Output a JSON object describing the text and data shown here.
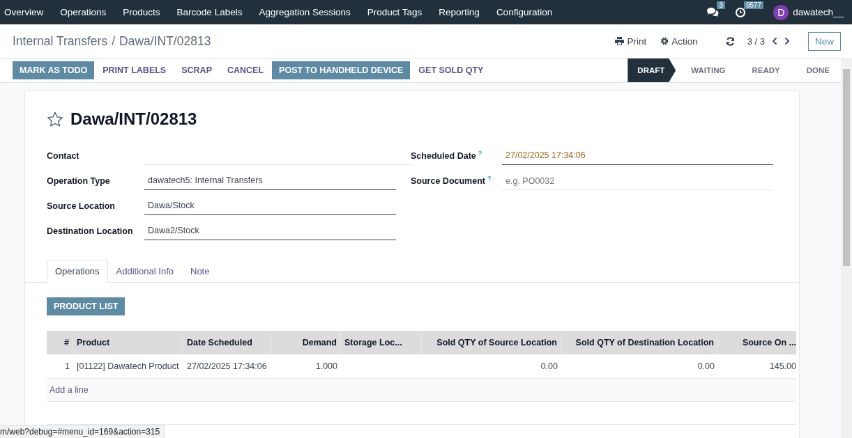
{
  "nav": {
    "items": [
      "Overview",
      "Operations",
      "Products",
      "Barcode Labels",
      "Aggregation Sessions",
      "Product Tags",
      "Reporting",
      "Configuration"
    ],
    "messages_badge": "3",
    "activity_badge": "9577",
    "avatar_letter": "D",
    "user": "dawatech__"
  },
  "control_panel": {
    "breadcrumb": [
      "Internal Transfers",
      "Dawa/INT/02813"
    ],
    "separator": "/",
    "print": "Print",
    "action": "Action",
    "pager": "3 / 3",
    "new": "New"
  },
  "action_buttons": [
    {
      "label": "MARK AS TODO",
      "kind": "primary"
    },
    {
      "label": "PRINT LABELS",
      "kind": "link"
    },
    {
      "label": "SCRAP",
      "kind": "link"
    },
    {
      "label": "CANCEL",
      "kind": "link"
    },
    {
      "label": "POST TO HANDHELD DEVICE",
      "kind": "primary"
    },
    {
      "label": "GET SOLD QTY",
      "kind": "link"
    }
  ],
  "statuses": [
    {
      "label": "DRAFT",
      "selected": true
    },
    {
      "label": "WAITING",
      "selected": false
    },
    {
      "label": "READY",
      "selected": false
    },
    {
      "label": "DONE",
      "selected": false
    }
  ],
  "form": {
    "title": "Dawa/INT/02813",
    "starred": false,
    "fields_left": [
      {
        "label": "Contact"
      },
      {
        "label": "Operation Type",
        "value": "dawatech5: Internal Transfers"
      },
      {
        "label": "Source Location",
        "value": "Dawa/Stock"
      },
      {
        "label": "Destination Location",
        "value": "Dawa2/Stock"
      }
    ],
    "fields_right": [
      {
        "label": "Scheduled Date",
        "help": "?",
        "value": "27/02/2025 17:34:06"
      },
      {
        "label": "Source Document",
        "help": "?",
        "placeholder": "e.g. PO0032"
      }
    ]
  },
  "tabs": [
    {
      "label": "Operations",
      "selected": true
    },
    {
      "label": "Additional Info",
      "selected": false
    },
    {
      "label": "Note",
      "selected": false
    }
  ],
  "product_list_button": "PRODUCT LIST",
  "table": {
    "columns": [
      {
        "label": "#",
        "kind": "number"
      },
      {
        "label": "Product",
        "kind": "text"
      },
      {
        "label": "Date Scheduled",
        "kind": "text"
      },
      {
        "label": "Demand",
        "kind": "number"
      },
      {
        "label": "Storage Loc...",
        "kind": "text"
      },
      {
        "label": "Sold QTY of Source Location",
        "kind": "number"
      },
      {
        "label": "Sold QTY of Destination Location",
        "kind": "number"
      },
      {
        "label": "Source On ...",
        "kind": "number"
      }
    ],
    "rows": [
      [
        "1",
        "[01122] Dawatech Product",
        "27/02/2025 17:34:06",
        "1.000",
        "",
        "0.00",
        "0.00",
        "145.00"
      ]
    ],
    "add_line": "Add a line"
  },
  "url_status": "m/web?debug=#menu_id=169&action=315"
}
